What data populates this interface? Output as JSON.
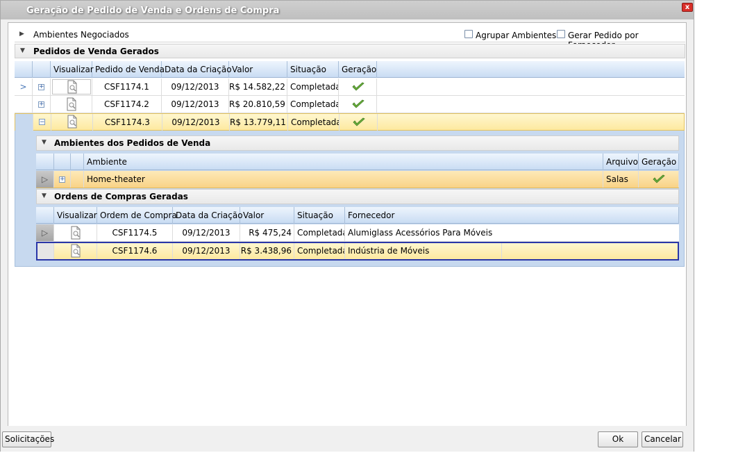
{
  "window": {
    "title": "Geração de Pedido de Venda e Ordens de Compra",
    "close": "x"
  },
  "ambientes_bar": {
    "label": "Ambientes Negociados",
    "agrupar_label": "Agrupar Ambientes",
    "gerar_label": "Gerar Pedido por Fornecedor"
  },
  "pedidos_section": {
    "label": "Pedidos de Venda Gerados"
  },
  "pedidos_grid": {
    "headers": [
      "Visualizar",
      "Pedido de Venda",
      "Data da Criação",
      "Valor",
      "Situação",
      "Geração"
    ],
    "rows": [
      {
        "pedido": "CSF1174.1",
        "data": "09/12/2013",
        "valor": "R$ 14.582,22",
        "situacao": "Completada",
        "expander": "+"
      },
      {
        "pedido": "CSF1174.2",
        "data": "09/12/2013",
        "valor": "R$ 20.810,59",
        "situacao": "Completada",
        "expander": "+"
      },
      {
        "pedido": "CSF1174.3",
        "data": "09/12/2013",
        "valor": "R$ 13.779,11",
        "situacao": "Completada",
        "expander": "−"
      }
    ],
    "row_marker": ">"
  },
  "ambientes_pedidos_section": {
    "label": "Ambientes dos Pedidos de Venda"
  },
  "ambientes_grid": {
    "headers": [
      "Ambiente",
      "Arquivo",
      "Geração"
    ],
    "rows": [
      {
        "ambiente": "Home-theater",
        "arquivo": "Salas",
        "expander": "+"
      }
    ],
    "row_marker": "▷"
  },
  "ordens_section": {
    "label": "Ordens de Compras Geradas"
  },
  "ordens_grid": {
    "headers": [
      "Visualizar",
      "Ordem de Compra",
      "Data da Criação",
      "Valor",
      "Situação",
      "Fornecedor"
    ],
    "rows": [
      {
        "ordem": "CSF1174.5",
        "data": "09/12/2013",
        "valor": "R$ 475,24",
        "situacao": "Completada",
        "fornecedor": "Alumiglass Acessórios Para Móveis"
      },
      {
        "ordem": "CSF1174.6",
        "data": "09/12/2013",
        "valor": "R$ 3.438,96",
        "situacao": "Completada",
        "fornecedor": "Indústria de Móveis"
      }
    ],
    "row_marker": "▷"
  },
  "footer": {
    "solicitacoes": "Solicitações",
    "ok": "Ok",
    "cancelar": "Cancelar"
  },
  "colors": {
    "header_blue": "#c9dcf3",
    "selected_yellow": "#fde9a0",
    "check_green": "#5aa02c",
    "focus_border": "#2a37a8"
  }
}
